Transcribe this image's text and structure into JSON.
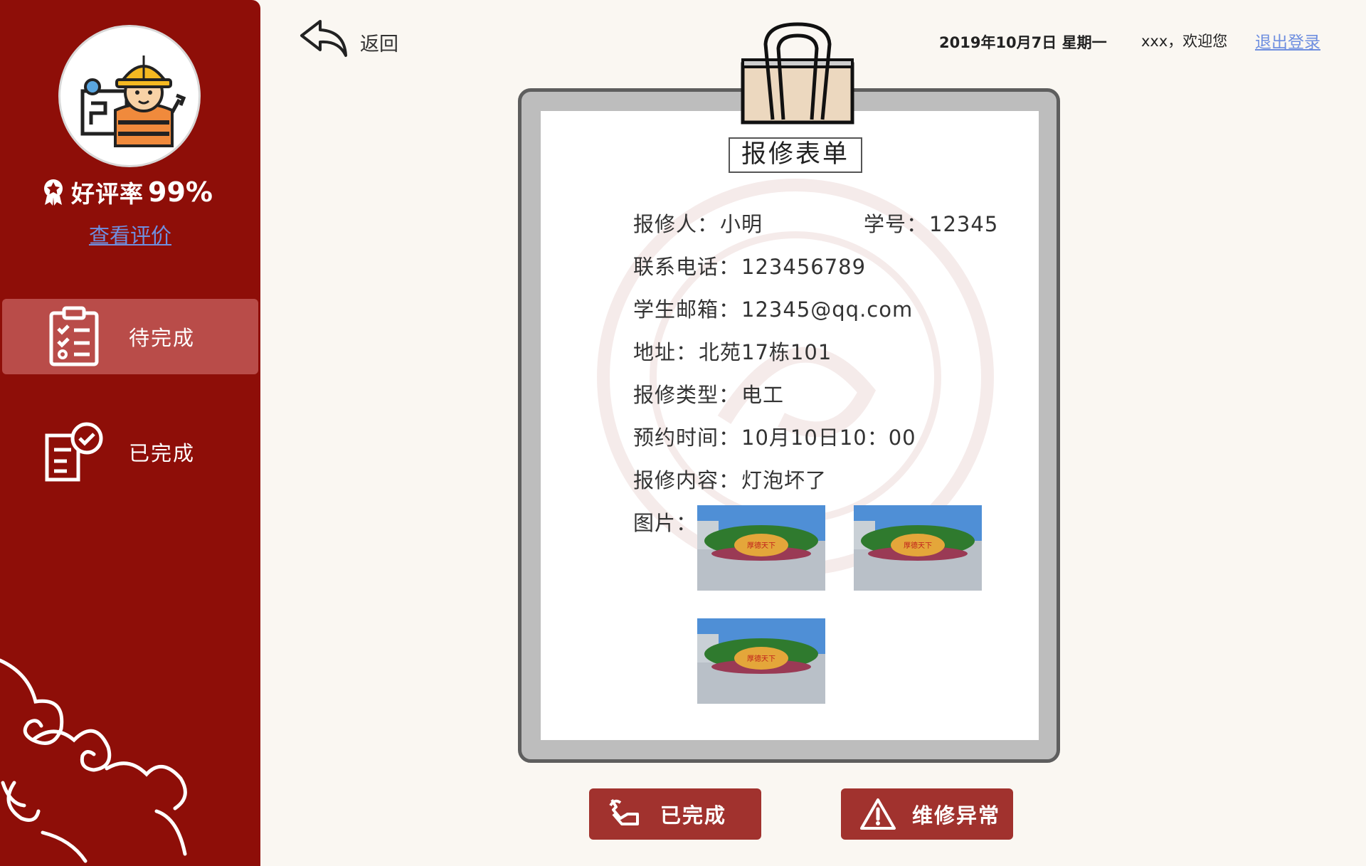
{
  "sidebar": {
    "rating_label": "好评率",
    "rating_value": "99%",
    "view_reviews": "查看评价",
    "items": [
      {
        "label": "待完成",
        "icon": "clipboard-checklist-icon",
        "active": true
      },
      {
        "label": "已完成",
        "icon": "document-check-icon",
        "active": false
      }
    ]
  },
  "header": {
    "back_label": "返回",
    "date": "2019年10月7日 星期一",
    "welcome": "xxx，欢迎您",
    "logout": "退出登录"
  },
  "form": {
    "title": "报修表单",
    "reporter_label": "报修人：",
    "reporter": "小明",
    "student_id_label": "学号：",
    "student_id": "12345",
    "phone_label": "联系电话：",
    "phone": "123456789",
    "email_label": "学生邮箱：",
    "email": "12345@qq.com",
    "address_label": "地址：",
    "address": "北苑17栋101",
    "type_label": "报修类型：",
    "type": "电工",
    "time_label": "预约时间：",
    "time": "10月10日10：00",
    "content_label": "报修内容：",
    "content": "灯泡坏了",
    "pictures_label": "图片：",
    "pictures": [
      {
        "caption": "厚德天下"
      },
      {
        "caption": "厚德天下"
      },
      {
        "caption": "厚德天下"
      }
    ]
  },
  "actions": {
    "complete_label": "已完成",
    "anomaly_label": "维修异常"
  },
  "colors": {
    "sidebar_bg": "#8e0e08",
    "active_item_bg": "#b94c49",
    "button_bg": "#a1322e",
    "link": "#6f8fe0",
    "page_bg": "#faf7f2"
  }
}
